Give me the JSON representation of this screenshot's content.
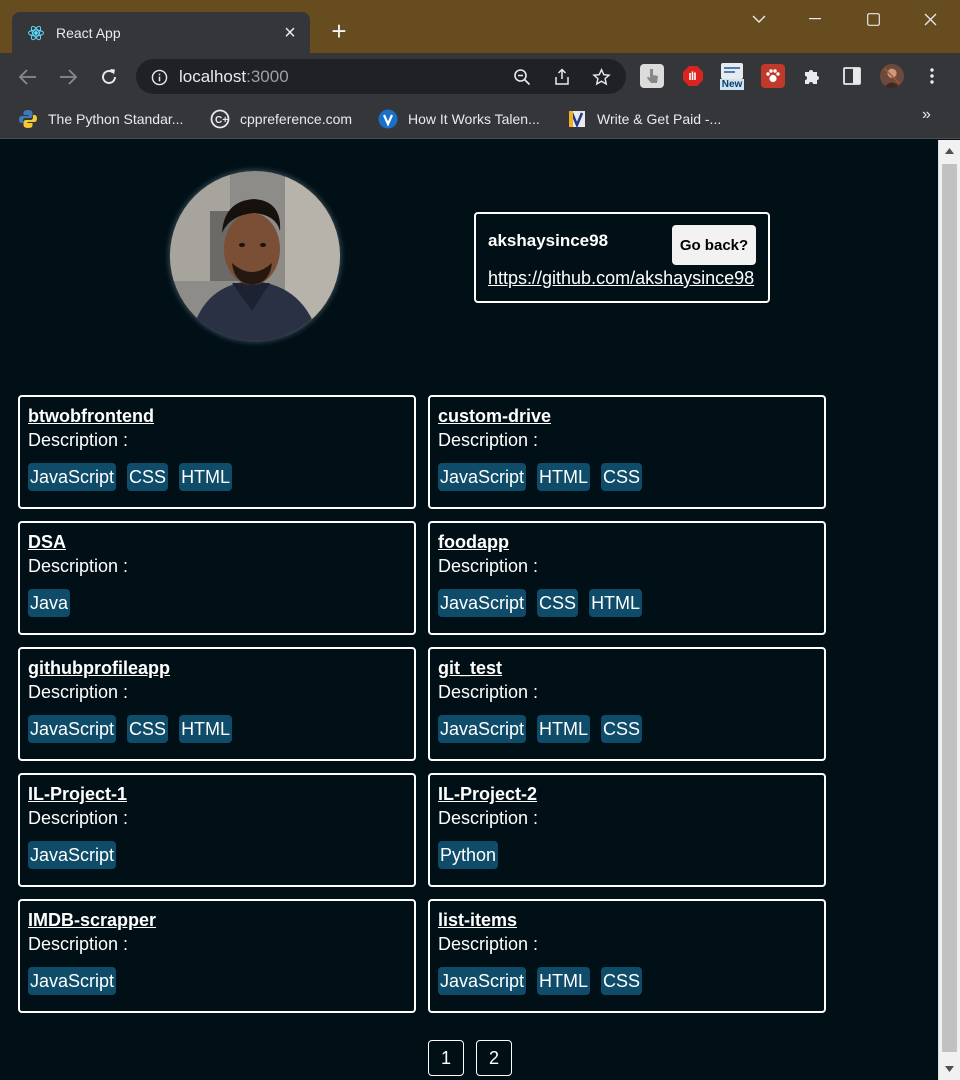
{
  "browser": {
    "tab_title": "React App",
    "new_tab_symbol": "+",
    "url_host": "localhost",
    "url_port": ":3000",
    "bookmarks": [
      {
        "label": "The Python Standar...",
        "icon": "python-icon"
      },
      {
        "label": "cppreference.com",
        "icon": "cppreference-icon"
      },
      {
        "label": "How It Works Talen...",
        "icon": "v-logo-icon"
      },
      {
        "label": "Write & Get Paid -...",
        "icon": "write-paid-icon"
      }
    ],
    "bookmarks_more": "»",
    "extension_badge": "New"
  },
  "profile": {
    "username": "akshaysince98",
    "github_url": "https://github.com/akshaysince98",
    "go_back_label": "Go back?"
  },
  "description_label": "Description :",
  "repos": [
    {
      "name": "btwobfrontend",
      "languages": [
        "JavaScript",
        "CSS",
        "HTML"
      ]
    },
    {
      "name": "custom-drive",
      "languages": [
        "JavaScript",
        "HTML",
        "CSS"
      ]
    },
    {
      "name": "DSA",
      "languages": [
        "Java"
      ]
    },
    {
      "name": "foodapp",
      "languages": [
        "JavaScript",
        "CSS",
        "HTML"
      ]
    },
    {
      "name": "githubprofileapp",
      "languages": [
        "JavaScript",
        "CSS",
        "HTML"
      ]
    },
    {
      "name": "git_test",
      "languages": [
        "JavaScript",
        "HTML",
        "CSS"
      ]
    },
    {
      "name": "IL-Project-1",
      "languages": [
        "JavaScript"
      ]
    },
    {
      "name": "IL-Project-2",
      "languages": [
        "Python"
      ]
    },
    {
      "name": "IMDB-scrapper",
      "languages": [
        "JavaScript"
      ]
    },
    {
      "name": "list-items",
      "languages": [
        "JavaScript",
        "HTML",
        "CSS"
      ]
    }
  ],
  "pagination": [
    "1",
    "2"
  ],
  "colors": {
    "page_bg": "#011017",
    "language_badge": "#0f4c6a",
    "titlebar": "#664c1e"
  }
}
